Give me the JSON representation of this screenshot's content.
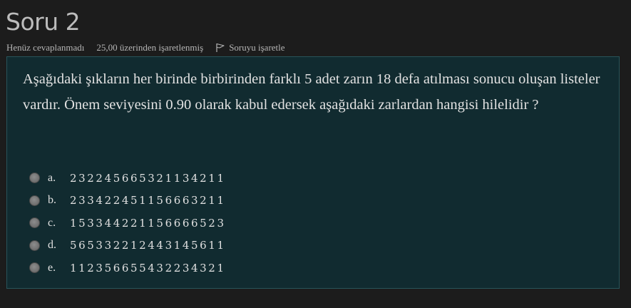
{
  "question": {
    "title": "Soru 2",
    "state": "Henüz cevaplanmadı",
    "grade": "25,00 üzerinden işaretlenmiş",
    "flag_label": "Soruyu işaretle",
    "flag_icon": "flag-icon",
    "text": "Aşağıdaki şıkların her birinde birbirinden farklı 5 adet zarın 18 defa atılması sonucu oluşan listeler vardır. Önem seviyesini 0.90 olarak kabul edersek aşağıdaki zarlardan hangisi hilelidir ?",
    "answers": [
      {
        "letter": "a.",
        "sequence": "232245665321134211"
      },
      {
        "letter": "b.",
        "sequence": "233422451156663211"
      },
      {
        "letter": "c.",
        "sequence": "153344221156666523"
      },
      {
        "letter": "d.",
        "sequence": "565332212443145611"
      },
      {
        "letter": "e.",
        "sequence": "112356655432234321"
      }
    ]
  }
}
